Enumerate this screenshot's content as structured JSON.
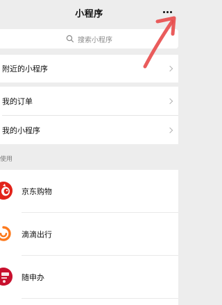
{
  "header": {
    "title": "小程序",
    "more_icon": "more-dots-icon"
  },
  "search": {
    "placeholder": "搜索小程序",
    "icon": "search-icon"
  },
  "menu": {
    "nearby": "附近的小程序",
    "orders": "我的订单",
    "my_mini_programs": "我的小程序"
  },
  "recent": {
    "header": "使用",
    "apps": [
      {
        "name": "京东购物",
        "icon": "jd-logo-icon"
      },
      {
        "name": "滴滴出行",
        "icon": "didi-logo-icon"
      },
      {
        "name": "随申办",
        "icon": "suishenban-logo-icon"
      }
    ]
  },
  "colors": {
    "background": "#ededed",
    "card": "#ffffff",
    "annotation_arrow": "#e84a4a",
    "jd_red": "#e2231a",
    "didi_orange": "#fc7a1e"
  }
}
